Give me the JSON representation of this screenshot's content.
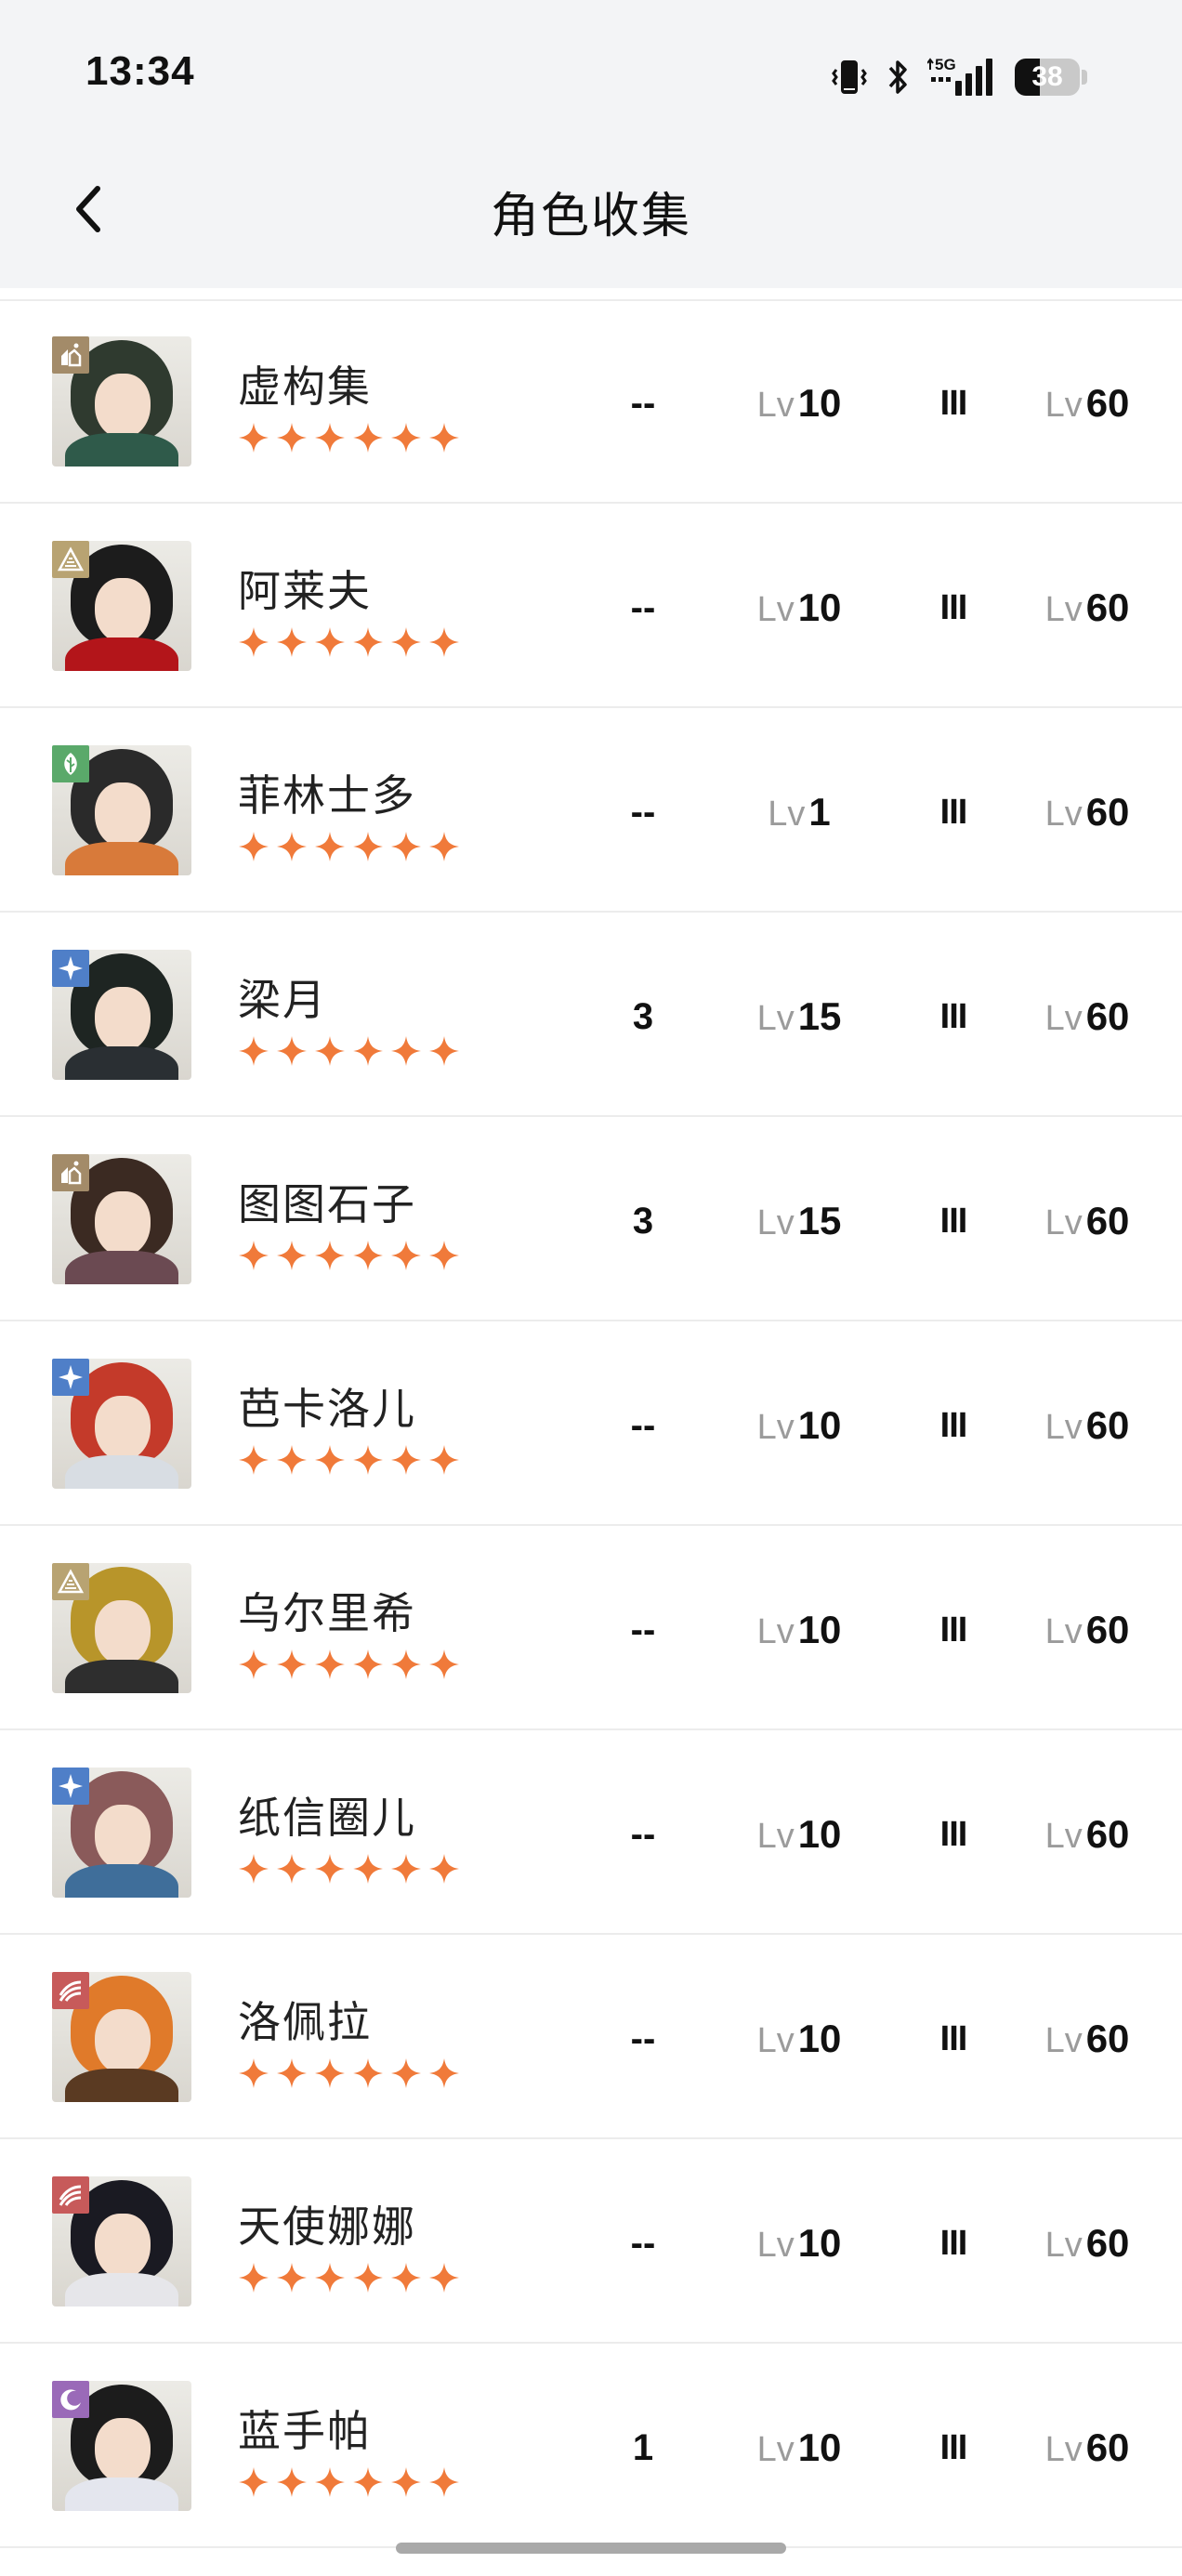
{
  "status_bar": {
    "time": "13:34",
    "network_label": "5G",
    "battery": "38",
    "battery_level_percent": 38,
    "icons": [
      "vibrate-icon",
      "bluetooth-icon",
      "signal-icon",
      "battery-icon"
    ]
  },
  "nav": {
    "back_icon": "chevron-left-icon",
    "title": "角色收集"
  },
  "colors": {
    "star": "#f07a3a",
    "divider": "#ececec",
    "header_bg": "#f3f4f6",
    "lv_prefix": "#9b9b9b"
  },
  "level_prefix": "Lv",
  "characters": [
    {
      "name": "虚构集",
      "rarity": 6,
      "duplicates": "--",
      "level": "10",
      "insight": "III",
      "max_level": "60",
      "element": "mineral",
      "element_color": "#a38b69",
      "hair": "#2f3a2f",
      "outfit": "#2f5a4a"
    },
    {
      "name": "阿莱夫",
      "rarity": 6,
      "duplicates": "--",
      "level": "10",
      "insight": "III",
      "max_level": "60",
      "element": "intellect",
      "element_color": "#b8a372",
      "hair": "#1c1c1c",
      "outfit": "#b3151a"
    },
    {
      "name": "菲林士多",
      "rarity": 6,
      "duplicates": "--",
      "level": "1",
      "insight": "III",
      "max_level": "60",
      "element": "plant",
      "element_color": "#5aa96a",
      "hair": "#2a2a2a",
      "outfit": "#d87a3a"
    },
    {
      "name": "梁月",
      "rarity": 6,
      "duplicates": "3",
      "level": "15",
      "insight": "III",
      "max_level": "60",
      "element": "star",
      "element_color": "#4f7fc8",
      "hair": "#1e2522",
      "outfit": "#2a2f33"
    },
    {
      "name": "图图石子",
      "rarity": 6,
      "duplicates": "3",
      "level": "15",
      "insight": "III",
      "max_level": "60",
      "element": "mineral",
      "element_color": "#a38b69",
      "hair": "#3b2a22",
      "outfit": "#6b4a52"
    },
    {
      "name": "芭卡洛儿",
      "rarity": 6,
      "duplicates": "--",
      "level": "10",
      "insight": "III",
      "max_level": "60",
      "element": "star",
      "element_color": "#4f7fc8",
      "hair": "#c43a2a",
      "outfit": "#d8dde3"
    },
    {
      "name": "乌尔里希",
      "rarity": 6,
      "duplicates": "--",
      "level": "10",
      "insight": "III",
      "max_level": "60",
      "element": "intellect",
      "element_color": "#b8a372",
      "hair": "#b8952a",
      "outfit": "#2e2e2e"
    },
    {
      "name": "纸信圈儿",
      "rarity": 6,
      "duplicates": "--",
      "level": "10",
      "insight": "III",
      "max_level": "60",
      "element": "star",
      "element_color": "#4f7fc8",
      "hair": "#8a5a5a",
      "outfit": "#3f6e9a"
    },
    {
      "name": "洛佩拉",
      "rarity": 6,
      "duplicates": "--",
      "level": "10",
      "insight": "III",
      "max_level": "60",
      "element": "beast",
      "element_color": "#c75a5a",
      "hair": "#e07a2a",
      "outfit": "#5a3a22"
    },
    {
      "name": "天使娜娜",
      "rarity": 6,
      "duplicates": "--",
      "level": "10",
      "insight": "III",
      "max_level": "60",
      "element": "beast",
      "element_color": "#c75a5a",
      "hair": "#1a1a22",
      "outfit": "#e6e6ea"
    },
    {
      "name": "蓝手帕",
      "rarity": 6,
      "duplicates": "1",
      "level": "10",
      "insight": "III",
      "max_level": "60",
      "element": "spirit",
      "element_color": "#9a6ab8",
      "hair": "#1c1c1c",
      "outfit": "#e4e6ee"
    }
  ]
}
